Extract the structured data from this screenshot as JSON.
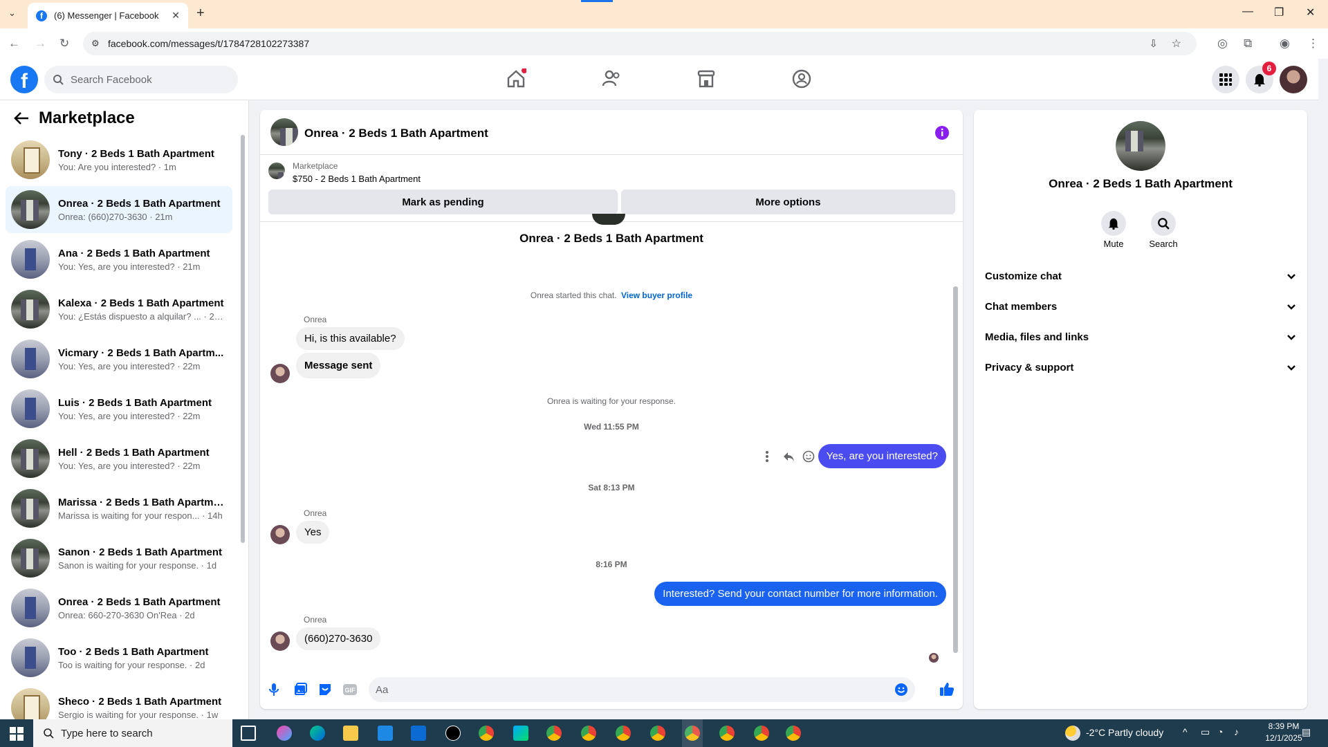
{
  "browser": {
    "tab_title": "(6) Messenger | Facebook",
    "url": "facebook.com/messages/t/1784728102273387",
    "new_tab": "+"
  },
  "fb": {
    "search_placeholder": "Search Facebook",
    "notifications_badge": "6",
    "brand_color": "#1877f2"
  },
  "sidebar": {
    "title": "Marketplace",
    "conversations": [
      {
        "name": "Tony · 2 Beds 1 Bath Apartment",
        "preview": "You: Are you interested? · 1m",
        "avatar": "room"
      },
      {
        "name": "Onrea · 2 Beds 1 Bath Apartment",
        "preview": "Onrea: (660)270-3630 · 21m",
        "avatar": "bldg",
        "active": true
      },
      {
        "name": "Ana · 2 Beds 1 Bath Apartment",
        "preview": "You: Yes, are you interested? · 21m",
        "avatar": "hall"
      },
      {
        "name": "Kalexa · 2 Beds 1 Bath Apartment",
        "preview": "You: ¿Estás dispuesto a alquilar? ... · 21m",
        "avatar": "bldg"
      },
      {
        "name": "Vicmary · 2 Beds 1 Bath Apartm...",
        "preview": "You: Yes, are you interested? · 22m",
        "avatar": "hall"
      },
      {
        "name": "Luis · 2 Beds 1 Bath Apartment",
        "preview": "You: Yes, are you interested? · 22m",
        "avatar": "hall"
      },
      {
        "name": "Hell · 2 Beds 1 Bath Apartment",
        "preview": "You: Yes, are you interested? · 22m",
        "avatar": "bldg"
      },
      {
        "name": "Marissa · 2 Beds 1 Bath Apartment",
        "preview": "Marissa is waiting for your respon... · 14h",
        "avatar": "bldg"
      },
      {
        "name": "Sanon · 2 Beds 1 Bath Apartment",
        "preview": "Sanon is waiting for your response. · 1d",
        "avatar": "bldg"
      },
      {
        "name": "Onrea · 2 Beds 1 Bath Apartment",
        "preview": "Onrea: 660-270-3630 On'Rea · 2d",
        "avatar": "hall"
      },
      {
        "name": "Too · 2 Beds 1 Bath Apartment",
        "preview": "Too is waiting for your response. · 2d",
        "avatar": "hall"
      },
      {
        "name": "Sheco · 2 Beds 1 Bath Apartment",
        "preview": "Sergio is waiting for your response. · 1w",
        "avatar": "room"
      }
    ]
  },
  "chat": {
    "title": "Onrea · 2 Beds 1 Bath Apartment",
    "listing_source": "Marketplace",
    "listing_title": "$750 - 2 Beds 1 Bath Apartment",
    "mark_pending": "Mark as pending",
    "more_options": "More options",
    "intro_name": "Onrea · 2 Beds 1 Bath Apartment",
    "started_text": "Onrea started this chat.",
    "view_buyer": "View buyer profile",
    "sender_name": "Onrea",
    "msg1": "Hi, is this available?",
    "msg2": "Message sent",
    "waiting": "Onrea is waiting for your response.",
    "ts1": "Wed 11:55 PM",
    "out1": "Yes, are you interested?",
    "ts2": "Sat 8:13 PM",
    "msg3": "Yes",
    "ts3": "8:16 PM",
    "out2": "Interested? Send your contact number for more information.",
    "msg4": "(660)270-3630",
    "composer_placeholder": "Aa",
    "outgoing_color": "#4b4cf0"
  },
  "details": {
    "name": "Onrea · 2 Beds 1 Bath Apartment",
    "mute": "Mute",
    "search": "Search",
    "sections": [
      "Customize chat",
      "Chat members",
      "Media, files and links",
      "Privacy & support"
    ]
  },
  "taskbar": {
    "search_placeholder": "Type here to search",
    "weather": "-2°C  Partly cloudy",
    "time": "8:39 PM",
    "date": "12/1/2025"
  }
}
